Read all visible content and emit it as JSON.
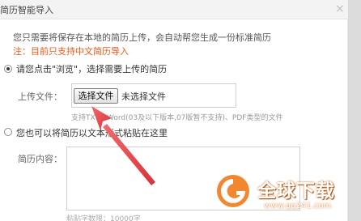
{
  "dialog": {
    "title": "简历智能导入",
    "close_symbol": "×"
  },
  "intro": "您只需要将保存在本地的简历上传，会自动帮您生成一份标准简历",
  "note": "注：目前只支持中文简历导入",
  "option_upload": {
    "label": "请您点击\"浏览\"，选择需要上传的简历",
    "checked": true,
    "field_label": "上传文件：",
    "choose_button": "选择文件",
    "file_status": "未选择文件",
    "support_hint": "支持TXT、Word(03及以下版本,07版暂不支持)、PDF类型的文件"
  },
  "option_paste": {
    "label": "您也可以将简历以文本形式粘贴在这里",
    "checked": false,
    "field_label": "简历内容：",
    "textarea_value": "",
    "limit_hint": "粘贴字数限：10000字"
  },
  "watermark": {
    "text": "全球下载",
    "url": "www.qq241.com",
    "color": "#f07a1a"
  },
  "annotation": {
    "arrow_color": "#e8454a"
  }
}
